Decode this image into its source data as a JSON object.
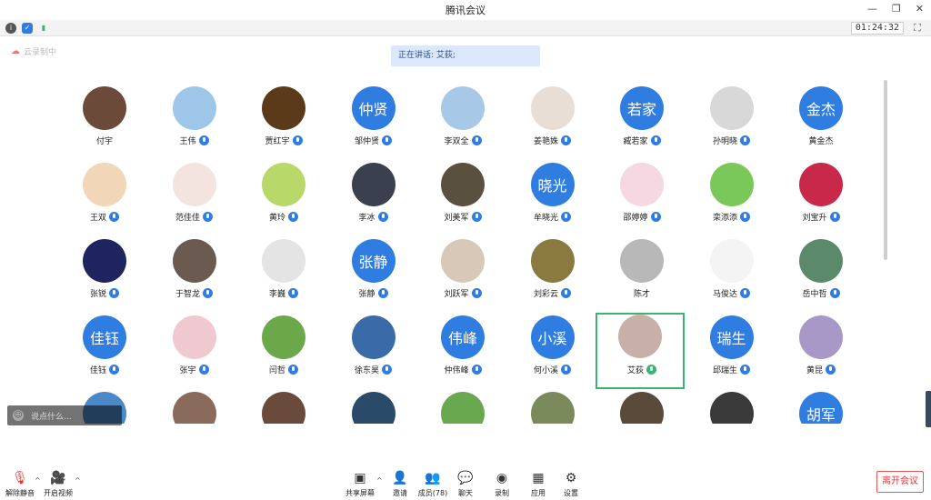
{
  "window": {
    "title": "腾讯会议",
    "minimize": "—",
    "restore": "❐",
    "close": "✕"
  },
  "topbar": {
    "timer": "01:24:32",
    "fullscreen": "⛶"
  },
  "cloud_rec": {
    "label": "云录制中"
  },
  "speaking": {
    "text": "正在讲话: 艾荻;"
  },
  "participants": [
    {
      "name": "付宇",
      "avatar_text": "",
      "color": "#6b4a3a",
      "mic": "none"
    },
    {
      "name": "王伟",
      "avatar_text": "",
      "color": "#9ec6e8",
      "mic": "blue"
    },
    {
      "name": "贾红宇",
      "avatar_text": "",
      "color": "#5b3a1a",
      "mic": "blue"
    },
    {
      "name": "邹仲贤",
      "avatar_text": "仲贤",
      "color": "#2f7de1",
      "mic": "blue"
    },
    {
      "name": "李双全",
      "avatar_text": "",
      "color": "#a8c8e8",
      "mic": "blue"
    },
    {
      "name": "姜艳姝",
      "avatar_text": "",
      "color": "#e8ded6",
      "mic": "blue"
    },
    {
      "name": "臧若家",
      "avatar_text": "若家",
      "color": "#2f7de1",
      "mic": "blue"
    },
    {
      "name": "孙明晓",
      "avatar_text": "",
      "color": "#d8d8d8",
      "mic": "blue"
    },
    {
      "name": "黄金杰",
      "avatar_text": "金杰",
      "color": "#2f7de1",
      "mic": "none"
    },
    {
      "name": "王双",
      "avatar_text": "",
      "color": "#f2d6b8",
      "mic": "blue"
    },
    {
      "name": "范佳佳",
      "avatar_text": "",
      "color": "#f4e4e0",
      "mic": "blue"
    },
    {
      "name": "黄玲",
      "avatar_text": "",
      "color": "#b8d86a",
      "mic": "blue"
    },
    {
      "name": "李冰",
      "avatar_text": "",
      "color": "#3a4050",
      "mic": "blue"
    },
    {
      "name": "刘美军",
      "avatar_text": "",
      "color": "#5a5040",
      "mic": "blue"
    },
    {
      "name": "牟晓光",
      "avatar_text": "晓光",
      "color": "#2f7de1",
      "mic": "blue"
    },
    {
      "name": "邵婷婷",
      "avatar_text": "",
      "color": "#f6d8e2",
      "mic": "blue"
    },
    {
      "name": "栾添添",
      "avatar_text": "",
      "color": "#7ac85a",
      "mic": "blue"
    },
    {
      "name": "刘宝升",
      "avatar_text": "",
      "color": "#c8284a",
      "mic": "blue"
    },
    {
      "name": "张锐",
      "avatar_text": "",
      "color": "#1e2460",
      "mic": "blue"
    },
    {
      "name": "于智龙",
      "avatar_text": "",
      "color": "#6a5a50",
      "mic": "blue"
    },
    {
      "name": "李巍",
      "avatar_text": "",
      "color": "#e4e4e4",
      "mic": "blue"
    },
    {
      "name": "张静",
      "avatar_text": "张静",
      "color": "#2f7de1",
      "mic": "blue"
    },
    {
      "name": "刘跃军",
      "avatar_text": "",
      "color": "#d8c8b8",
      "mic": "blue"
    },
    {
      "name": "刘彩云",
      "avatar_text": "",
      "color": "#8a7a40",
      "mic": "blue"
    },
    {
      "name": "陈才",
      "avatar_text": "",
      "color": "#b8b8b8",
      "mic": "none"
    },
    {
      "name": "马俊达",
      "avatar_text": "",
      "color": "#f4f4f4",
      "mic": "blue"
    },
    {
      "name": "岳中哲",
      "avatar_text": "",
      "color": "#5a8a6a",
      "mic": "blue"
    },
    {
      "name": "佳钰",
      "avatar_text": "佳钰",
      "color": "#2f7de1",
      "mic": "blue"
    },
    {
      "name": "张宇",
      "avatar_text": "",
      "color": "#f0c8d0",
      "mic": "blue"
    },
    {
      "name": "闫哲",
      "avatar_text": "",
      "color": "#6aa84a",
      "mic": "blue"
    },
    {
      "name": "徐东昊",
      "avatar_text": "",
      "color": "#3a6aa8",
      "mic": "blue"
    },
    {
      "name": "仲伟峰",
      "avatar_text": "伟峰",
      "color": "#2f7de1",
      "mic": "blue"
    },
    {
      "name": "何小溪",
      "avatar_text": "小溪",
      "color": "#2f7de1",
      "mic": "blue"
    },
    {
      "name": "艾荻",
      "avatar_text": "",
      "color": "#c8b0a8",
      "mic": "green",
      "active": true
    },
    {
      "name": "邱瑞生",
      "avatar_text": "瑞生",
      "color": "#2f7de1",
      "mic": "blue"
    },
    {
      "name": "黄昆",
      "avatar_text": "",
      "color": "#a898c8",
      "mic": "blue"
    },
    {
      "name": "",
      "avatar_text": "",
      "color": "#4a88c8",
      "mic": "none"
    },
    {
      "name": "",
      "avatar_text": "",
      "color": "#8a6a5a",
      "mic": "none"
    },
    {
      "name": "",
      "avatar_text": "",
      "color": "#6a4a3a",
      "mic": "none"
    },
    {
      "name": "",
      "avatar_text": "",
      "color": "#2a4a6a",
      "mic": "none"
    },
    {
      "name": "",
      "avatar_text": "",
      "color": "#6aa850",
      "mic": "none"
    },
    {
      "name": "",
      "avatar_text": "",
      "color": "#7a8a5a",
      "mic": "none"
    },
    {
      "name": "",
      "avatar_text": "",
      "color": "#5a4a3a",
      "mic": "none"
    },
    {
      "name": "",
      "avatar_text": "",
      "color": "#3a3a3a",
      "mic": "none"
    },
    {
      "name": "",
      "avatar_text": "胡军",
      "color": "#2f7de1",
      "mic": "none"
    }
  ],
  "chat": {
    "placeholder": "说点什么..."
  },
  "bottombar": {
    "mute": "解除静音",
    "video": "开启视频",
    "share": "共享屏幕",
    "invite": "邀请",
    "members": "成员(78)",
    "chat": "聊天",
    "record": "录制",
    "apps": "应用",
    "settings": "设置",
    "leave": "离开会议"
  },
  "colors": {
    "accent": "#2f7de1",
    "active_border": "#3cb371",
    "leave": "#e33333"
  }
}
